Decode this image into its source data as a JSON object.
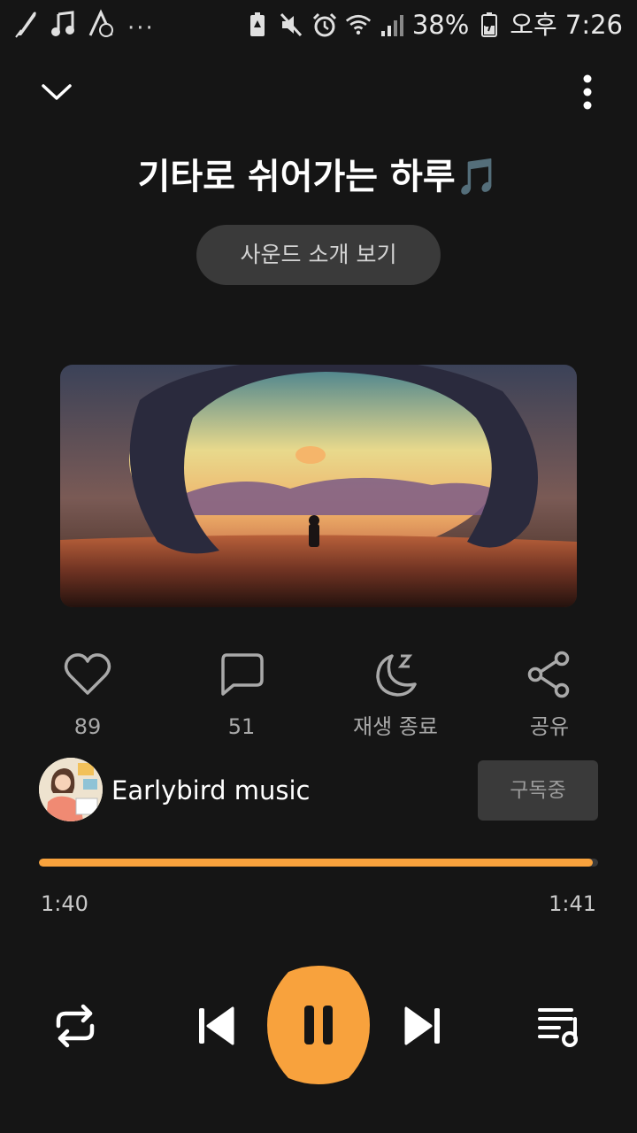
{
  "statusbar": {
    "left_icons": [
      "feather-icon",
      "music-note-icon",
      "app-icon",
      "more-dots-icon"
    ],
    "dots": "···",
    "battery_pct": "38%",
    "time": "오후 7:26"
  },
  "header": {
    "title": "기타로 쉬어가는 하루🎵",
    "intro_button": "사운드 소개 보기"
  },
  "actions": {
    "like_count": "89",
    "comment_count": "51",
    "sleep_timer_label": "재생 종료",
    "share_label": "공유"
  },
  "artist": {
    "name": "Earlybird music",
    "subscribe_label": "구독중"
  },
  "player": {
    "current_time": "1:40",
    "total_time": "1:41",
    "progress": 0.99
  },
  "colors": {
    "accent": "#f8a23d",
    "background": "#151515",
    "button_bg": "#3a3a3a"
  }
}
